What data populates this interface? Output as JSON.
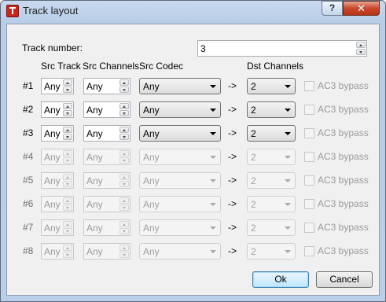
{
  "window": {
    "title": "Track layout",
    "help_label": "?",
    "close_label": "✕"
  },
  "track_number": {
    "label": "Track number:",
    "value": "3"
  },
  "columns": {
    "src_track": "Src Track",
    "src_channels": "Src Channels",
    "src_codec": "Src Codec",
    "dst_channels": "Dst Channels"
  },
  "rows": [
    {
      "label": "#1",
      "src_track": "Any",
      "src_channels": "Any",
      "src_codec": "Any",
      "arrow": "->",
      "dst_channels": "2",
      "ac3": "AC3 bypass"
    },
    {
      "label": "#2",
      "src_track": "Any",
      "src_channels": "Any",
      "src_codec": "Any",
      "arrow": "->",
      "dst_channels": "2",
      "ac3": "AC3 bypass"
    },
    {
      "label": "#3",
      "src_track": "Any",
      "src_channels": "Any",
      "src_codec": "Any",
      "arrow": "->",
      "dst_channels": "2",
      "ac3": "AC3 bypass"
    },
    {
      "label": "#4",
      "src_track": "Any",
      "src_channels": "Any",
      "src_codec": "Any",
      "arrow": "->",
      "dst_channels": "2",
      "ac3": "AC3 bypass"
    },
    {
      "label": "#5",
      "src_track": "Any",
      "src_channels": "Any",
      "src_codec": "Any",
      "arrow": "->",
      "dst_channels": "2",
      "ac3": "AC3 bypass"
    },
    {
      "label": "#6",
      "src_track": "Any",
      "src_channels": "Any",
      "src_codec": "Any",
      "arrow": "->",
      "dst_channels": "2",
      "ac3": "AC3 bypass"
    },
    {
      "label": "#7",
      "src_track": "Any",
      "src_channels": "Any",
      "src_codec": "Any",
      "arrow": "->",
      "dst_channels": "2",
      "ac3": "AC3 bypass"
    },
    {
      "label": "#8",
      "src_track": "Any",
      "src_channels": "Any",
      "src_codec": "Any",
      "arrow": "->",
      "dst_channels": "2",
      "ac3": "AC3 bypass"
    }
  ],
  "buttons": {
    "ok": "Ok",
    "cancel": "Cancel"
  }
}
